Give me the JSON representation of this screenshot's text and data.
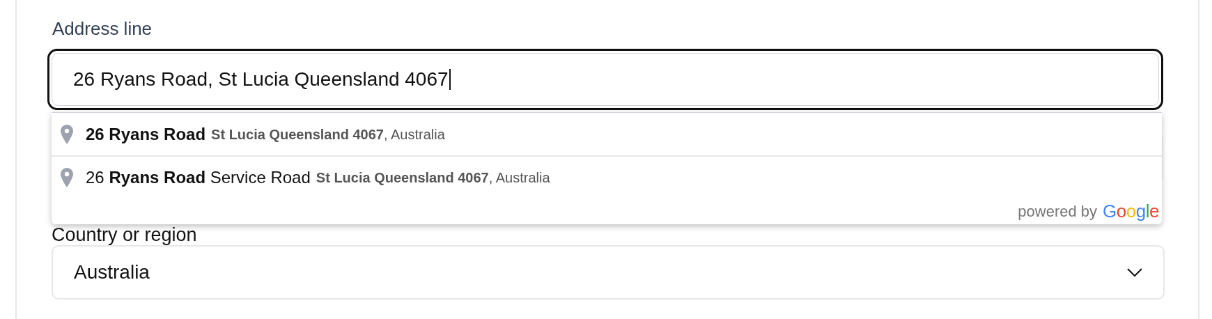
{
  "address": {
    "label": "Address line",
    "value": "26 Ryans Road, St Lucia Queensland 4067",
    "focused": true
  },
  "suggestions": [
    {
      "main": "**26 Ryans Road**",
      "secondary": "**St Lucia Queensland 4067**, Australia"
    },
    {
      "main": "26 **Ryans Road** Service Road",
      "secondary": "**St Lucia Queensland 4067**, Australia"
    }
  ],
  "attribution": {
    "text": "powered by",
    "brand": "Google"
  },
  "country": {
    "label": "Country or region",
    "value": "Australia"
  }
}
